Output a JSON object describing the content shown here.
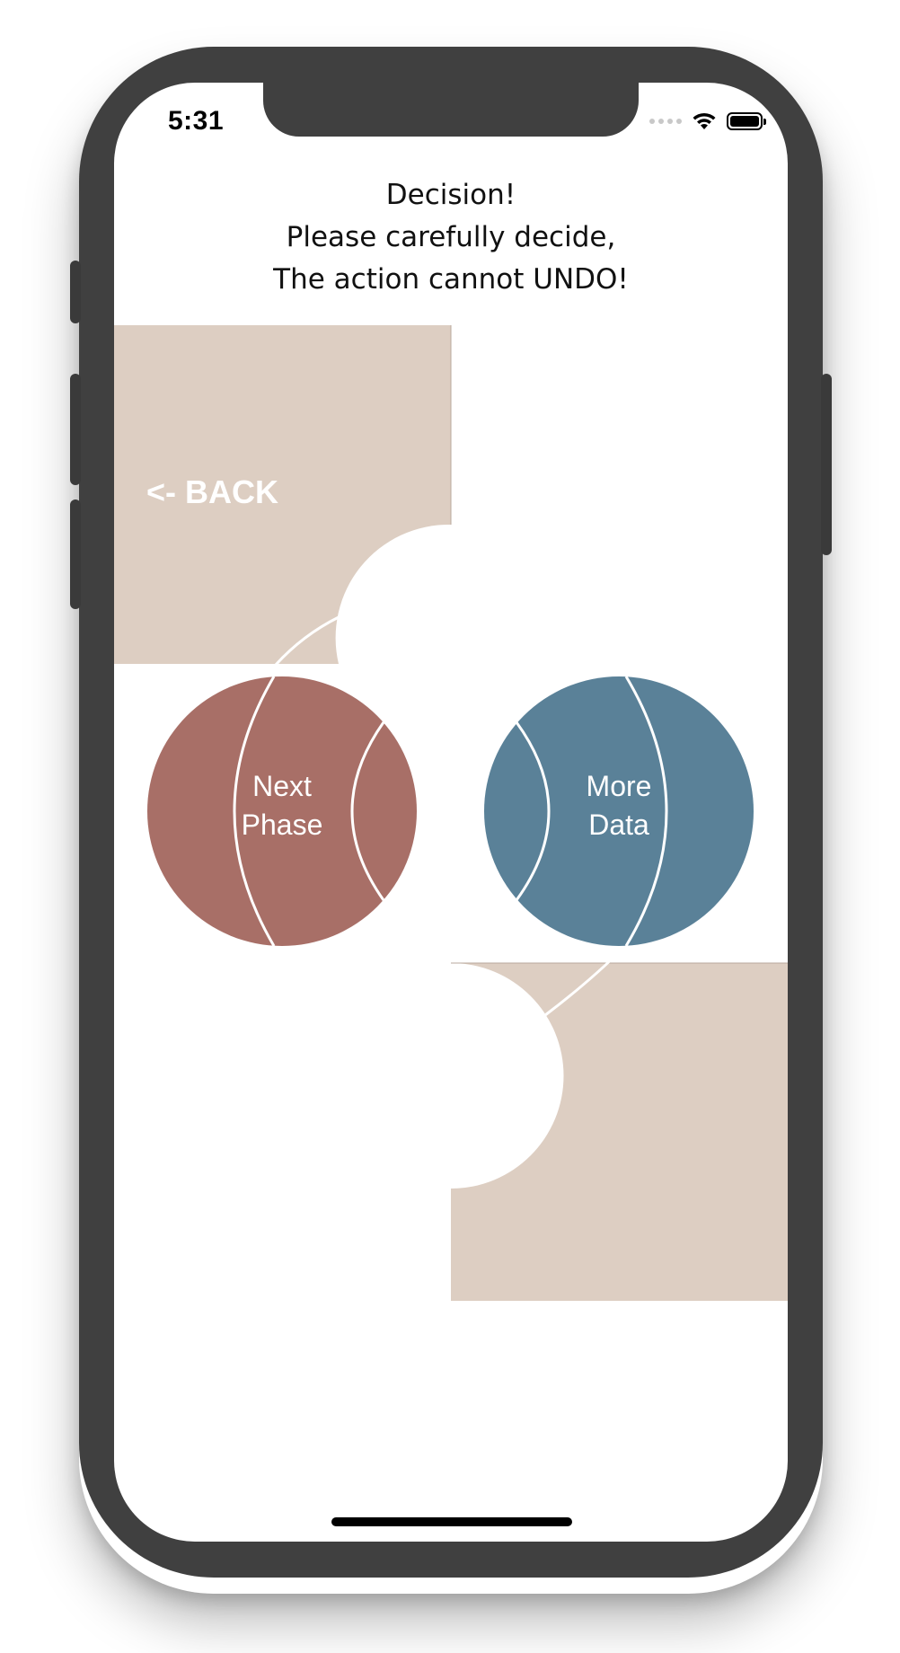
{
  "status_bar": {
    "time": "5:31"
  },
  "header": {
    "line1": "Decision!",
    "line2": "Please carefully decide,",
    "line3": "The action cannot UNDO!"
  },
  "back_button": {
    "label": "<- BACK"
  },
  "next_phase_button": {
    "line1": "Next",
    "line2": "Phase",
    "color": "#A86F67"
  },
  "more_data_button": {
    "line1": "More",
    "line2": "Data",
    "color": "#5A8198"
  },
  "colors": {
    "panel": "#DDCEC2",
    "phone_frame": "#404040"
  }
}
